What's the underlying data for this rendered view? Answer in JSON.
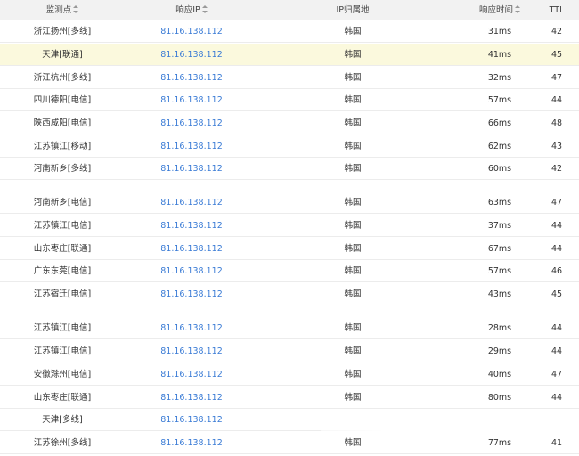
{
  "header": {
    "node": "监测点",
    "ip": "响应IP",
    "location": "IP归属地",
    "response_time": "响应时间",
    "ttl": "TTL"
  },
  "rows": [
    {
      "node": "浙江扬州[多线]",
      "ip": "81.16.138.112",
      "location": "韩国",
      "time": "31ms",
      "ttl": "42"
    },
    {
      "node": "天津[联通]",
      "ip": "81.16.138.112",
      "location": "韩国",
      "time": "41ms",
      "ttl": "45",
      "highlight": true
    },
    {
      "node": "浙江杭州[多线]",
      "ip": "81.16.138.112",
      "location": "韩国",
      "time": "32ms",
      "ttl": "47"
    },
    {
      "node": "四川德阳[电信]",
      "ip": "81.16.138.112",
      "location": "韩国",
      "time": "57ms",
      "ttl": "44"
    },
    {
      "node": "陕西咸阳[电信]",
      "ip": "81.16.138.112",
      "location": "韩国",
      "time": "66ms",
      "ttl": "48"
    },
    {
      "node": "江苏镇江[移动]",
      "ip": "81.16.138.112",
      "location": "韩国",
      "time": "62ms",
      "ttl": "43"
    },
    {
      "node": "河南新乡[多线]",
      "ip": "81.16.138.112",
      "location": "韩国",
      "time": "60ms",
      "ttl": "42"
    },
    {
      "node": "河南新乡[电信]",
      "ip": "81.16.138.112",
      "location": "韩国",
      "time": "63ms",
      "ttl": "47"
    },
    {
      "node": "江苏镇江[电信]",
      "ip": "81.16.138.112",
      "location": "韩国",
      "time": "37ms",
      "ttl": "44"
    },
    {
      "node": "山东枣庄[联通]",
      "ip": "81.16.138.112",
      "location": "韩国",
      "time": "67ms",
      "ttl": "44"
    },
    {
      "node": "广东东莞[电信]",
      "ip": "81.16.138.112",
      "location": "韩国",
      "time": "57ms",
      "ttl": "46"
    },
    {
      "node": "江苏宿迁[电信]",
      "ip": "81.16.138.112",
      "location": "韩国",
      "time": "43ms",
      "ttl": "45"
    },
    {
      "node": "江苏镇江[电信]",
      "ip": "81.16.138.112",
      "location": "韩国",
      "time": "28ms",
      "ttl": "44"
    },
    {
      "node": "江苏镇江[电信]",
      "ip": "81.16.138.112",
      "location": "韩国",
      "time": "29ms",
      "ttl": "44"
    },
    {
      "node": "安徽滁州[电信]",
      "ip": "81.16.138.112",
      "location": "韩国",
      "time": "40ms",
      "ttl": "47"
    },
    {
      "node": "山东枣庄[联通]",
      "ip": "81.16.138.112",
      "location": "韩国",
      "time": "80ms",
      "ttl": "44"
    },
    {
      "node": "天津[多线]",
      "ip": "81.16.138.112",
      "location": "",
      "time": "",
      "ttl": ""
    },
    {
      "node": "江苏徐州[多线]",
      "ip": "81.16.138.112",
      "location": "韩国",
      "time": "77ms",
      "ttl": "41"
    }
  ],
  "colors": {
    "header_bg": "#f2f2f2",
    "highlight_bg": "#fbf9dd",
    "ip_link": "#3a7bd5",
    "row_border": "#ececec"
  }
}
